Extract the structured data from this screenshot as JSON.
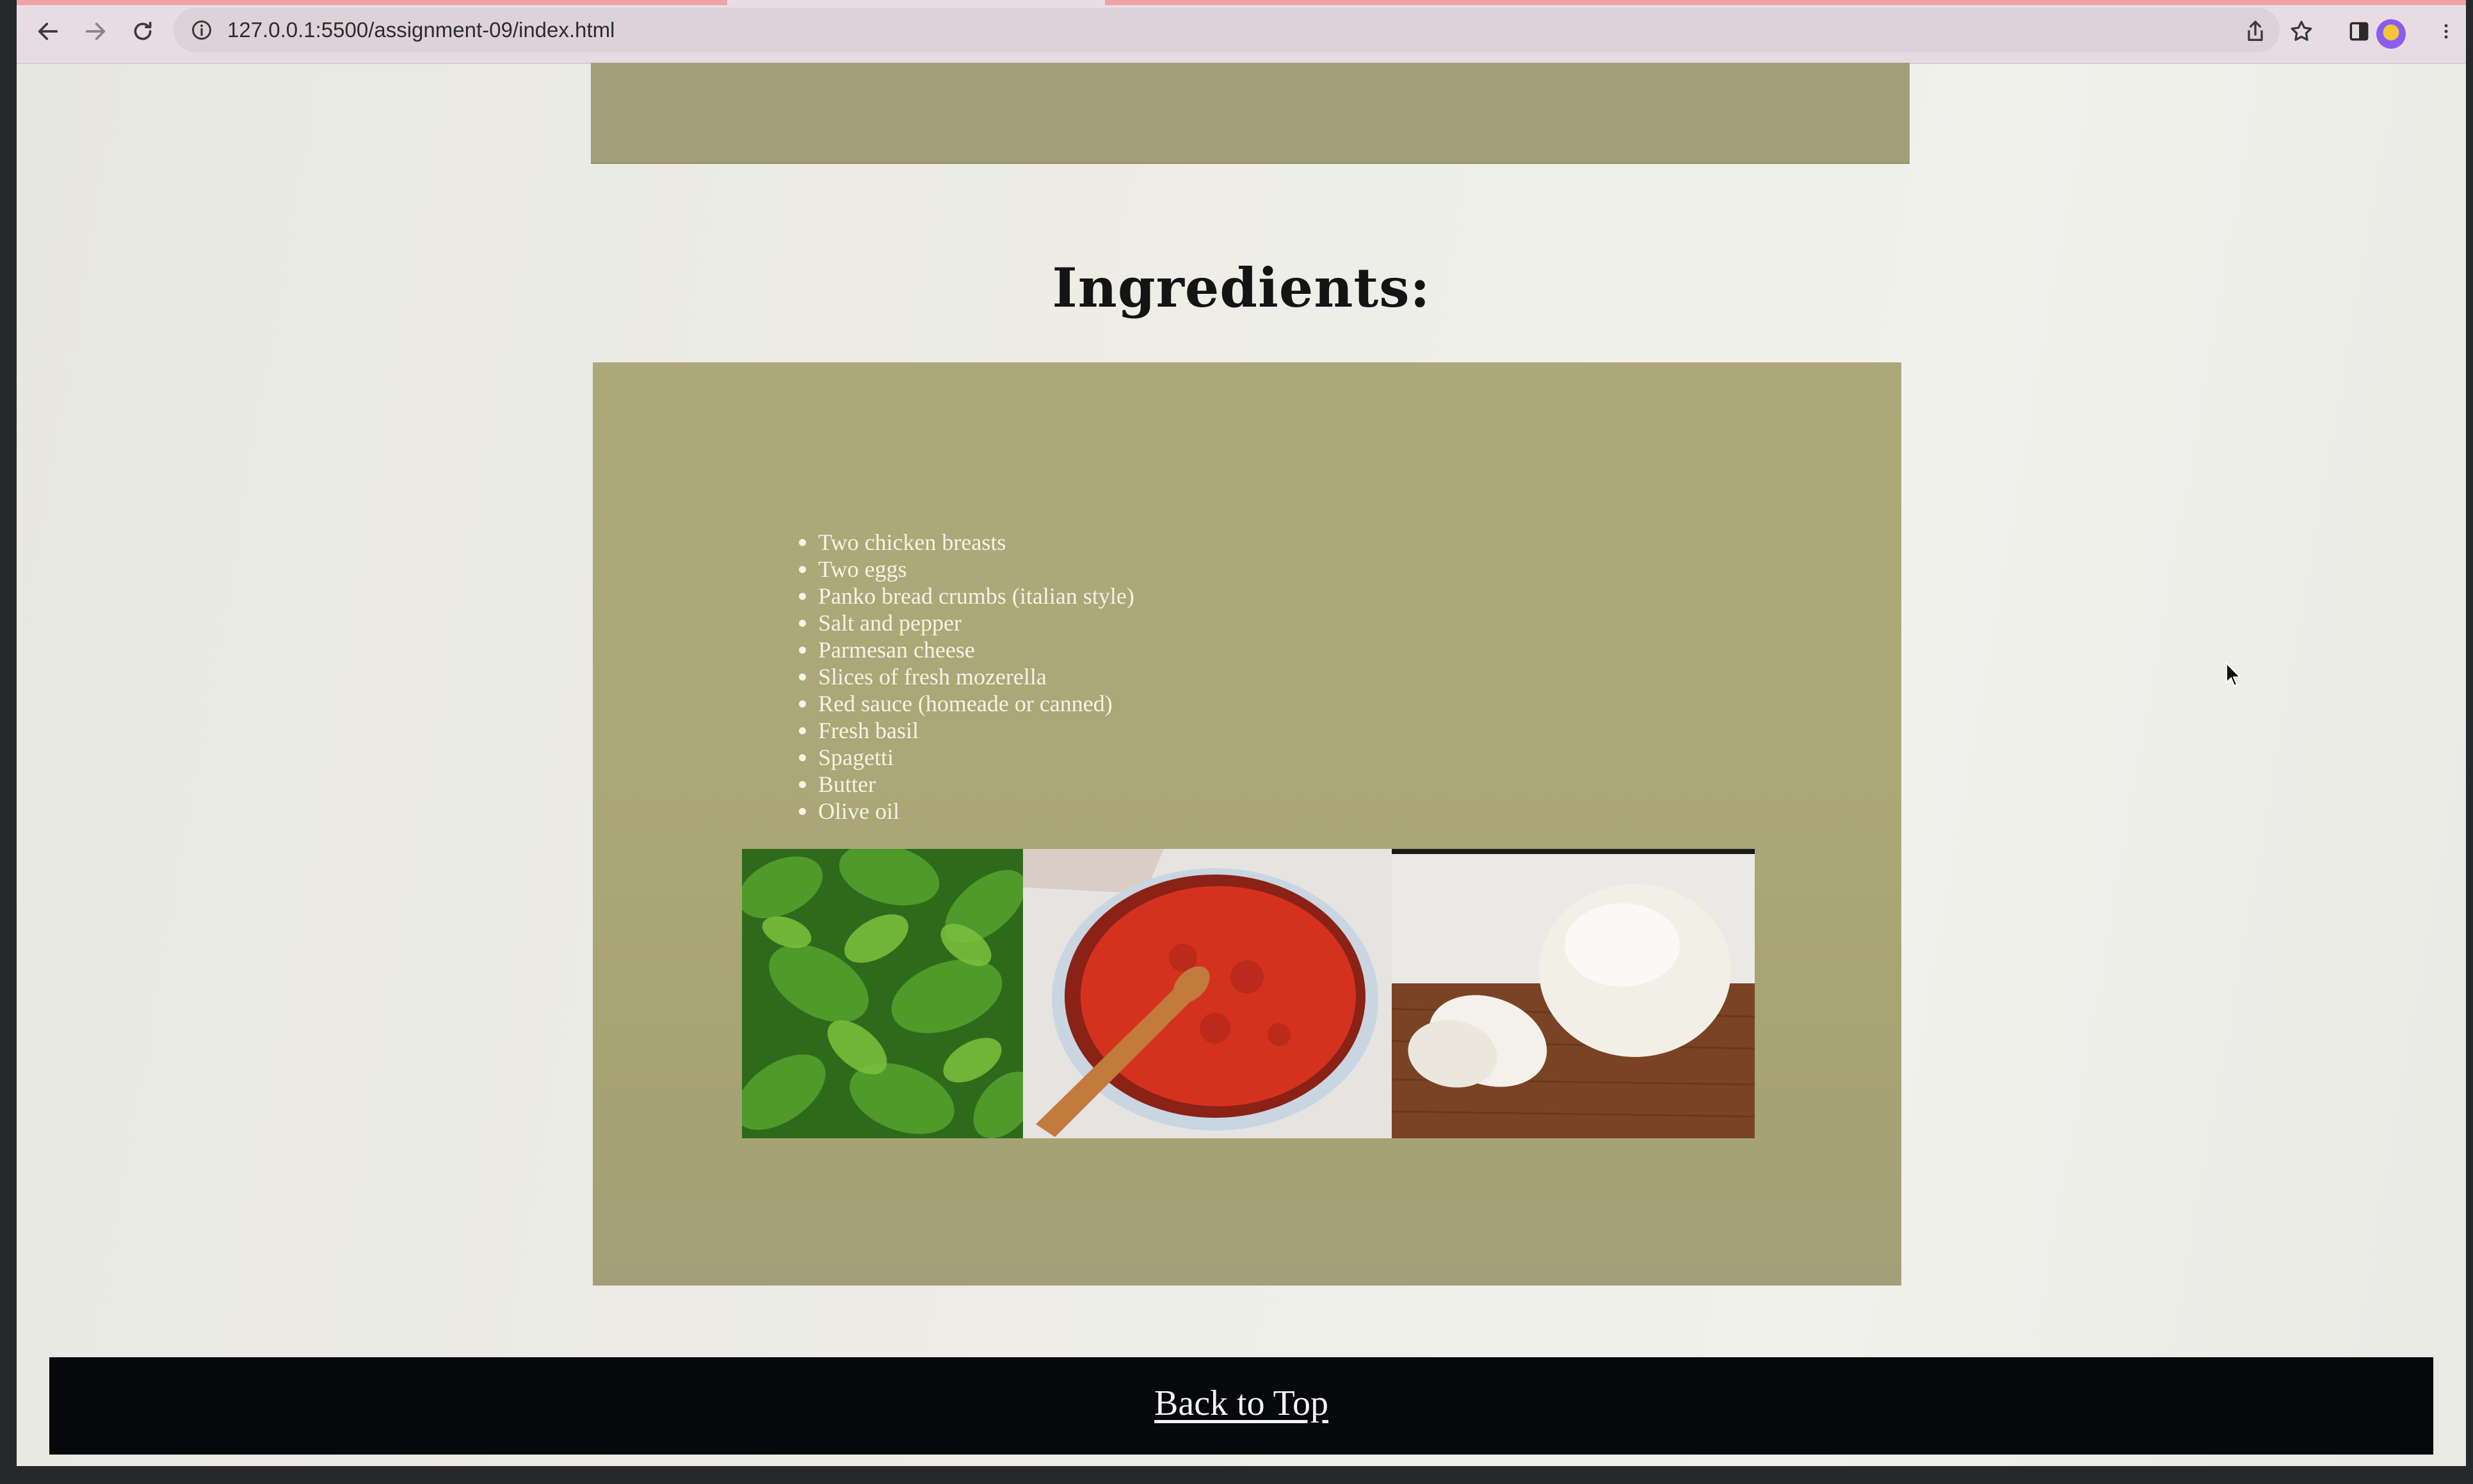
{
  "browser": {
    "url": "127.0.0.1:5500/assignment-09/index.html",
    "icons": [
      "back-arrow-icon",
      "forward-arrow-icon",
      "reload-icon",
      "info-icon",
      "share-icon",
      "bookmark-star-icon",
      "side-panel-icon",
      "profile-avatar",
      "more-menu-icon"
    ]
  },
  "page": {
    "section_title": "Ingredients:",
    "ingredients": [
      "Two chicken breasts",
      "Two eggs",
      "Panko bread crumbs (italian style)",
      "Salt and pepper",
      "Parmesan cheese",
      "Slices of fresh mozerella",
      "Red sauce (homeade or canned)",
      "Fresh basil",
      "Spagetti",
      "Butter",
      "Olive oil"
    ],
    "photos": [
      "fresh-basil-photo",
      "red-sauce-pot-photo",
      "mozzarella-photo"
    ],
    "footer": {
      "back_to_top": "Back to Top"
    }
  },
  "colors": {
    "panel": "#aca776",
    "footer": "#07080c",
    "page_background": "#ededE6"
  }
}
